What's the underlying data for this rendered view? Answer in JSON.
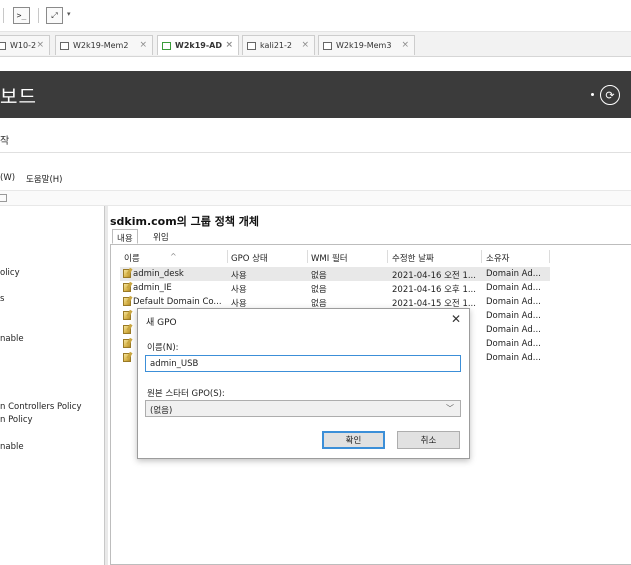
{
  "vm_toolbar": {
    "console_icon": "terminal-icon",
    "fit_icon": "resize-icon",
    "caret": "▾"
  },
  "tabs": [
    {
      "label": "W10-2",
      "close": "×"
    },
    {
      "label": "W2k19-Mem2",
      "close": "×"
    },
    {
      "label": "W2k19-AD",
      "close": "×"
    },
    {
      "label": "kali21-2",
      "close": "×"
    },
    {
      "label": "W2k19-Mem3",
      "close": "×"
    }
  ],
  "server_manager": {
    "title": "보드",
    "refresh_icon": "⟳",
    "subheader": "작"
  },
  "menubar": {
    "window": "(W)",
    "help": "도움말(H)"
  },
  "tree": {
    "items": [
      "olicy",
      "s",
      "nable",
      "n Controllers Policy",
      "n Policy",
      "nable"
    ]
  },
  "gpo_pane": {
    "title": "sdkim.com의 그룹 정책 개체",
    "tab_contents": "내용",
    "tab_delegation": "위임",
    "columns": [
      "이름",
      "GPO 상태",
      "WMI 필터",
      "수정한 날짜",
      "소유자"
    ],
    "sort_glyph": "^",
    "rows": [
      [
        "admin_desk",
        "사용",
        "없음",
        "2021-04-16 오전 1...",
        "Domain Ad..."
      ],
      [
        "admin_IE",
        "사용",
        "없음",
        "2021-04-16 오후 1...",
        "Domain Ad..."
      ],
      [
        "Default Domain Co...",
        "사용",
        "없음",
        "2021-04-15 오전 1...",
        "Domain Ad..."
      ],
      [
        "",
        "",
        "",
        "",
        "Domain Ad..."
      ],
      [
        "",
        "",
        "",
        "",
        "Domain Ad..."
      ],
      [
        "",
        "",
        "",
        "",
        "Domain Ad..."
      ],
      [
        "",
        "",
        "",
        "",
        "Domain Ad..."
      ]
    ]
  },
  "dialog": {
    "title": "새 GPO",
    "close": "✕",
    "name_label": "이름(N):",
    "name_value": "admin_USB",
    "starter_label": "원본 스타터 GPO(S):",
    "starter_value": "(없음)",
    "ok": "확인",
    "cancel": "취소"
  }
}
